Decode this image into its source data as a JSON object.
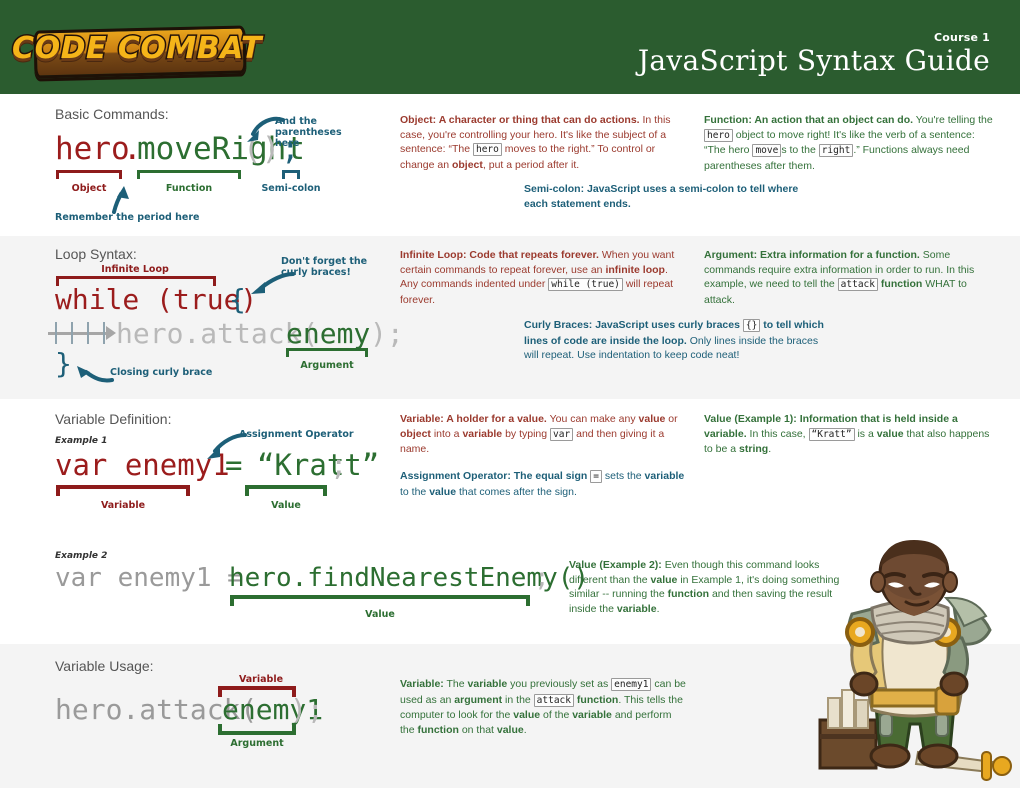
{
  "header": {
    "logo_text": "CODE COMBAT",
    "course_label": "Course 1",
    "title": "JavaScript Syntax Guide",
    "bg_color": "#2b5c2f"
  },
  "sections": [
    {
      "id": "basic-commands",
      "title": "Basic Commands:",
      "code": {
        "object": "hero",
        "dot": ".",
        "function": "moveRight",
        "parens": "()",
        "semicolon": ";"
      },
      "labels": {
        "object": "Object",
        "function": "Function",
        "semicolon": "Semi-colon",
        "parens_note_line1": "And the",
        "parens_note_line2": "parentheses here",
        "period_note": "Remember the period here"
      },
      "notes": [
        {
          "color": "#9b3a2e",
          "bold_lead": "Object: A character or thing that can do actions.",
          "body_1": " In this case, you're controlling your hero. It's like the subject of a sentence: “The ",
          "kb_1": "hero",
          "body_2": " moves to the right.” To control or change an ",
          "bold_2": "object",
          "body_3": ", put a period after it."
        },
        {
          "color": "#34713a",
          "bold_lead": "Function: An action that an object can do.",
          "body_1": " You're telling the ",
          "kb_1": "hero",
          "body_2": " object to move right! It's like the verb of a sentence: “The hero ",
          "kb_2": "move",
          "body_3": "s to the ",
          "kb_3": "right",
          "body_4": ".” Functions always need parentheses after them."
        },
        {
          "color": "#1d5f78",
          "bold_lead": "Semi-colon:  JavaScript uses a semi-colon to tell where each statement ends."
        }
      ]
    },
    {
      "id": "loop-syntax",
      "title": "Loop Syntax:",
      "code": {
        "line1": "while (true) {",
        "line1_keyword": "while (true)",
        "line1_brace": "{",
        "line2_prefix": "hero.attack(",
        "line2_arg": "enemy",
        "line2_suffix": ");",
        "line3": "}"
      },
      "labels": {
        "infinite_loop": "Infinite Loop",
        "argument": "Argument",
        "curly_note_line1": "Don't forget the",
        "curly_note_line2": "curly braces!",
        "closing_brace_note": "Closing curly brace"
      },
      "notes": [
        {
          "color": "#9b3a2e",
          "bold_lead": "Infinite Loop: Code that repeats forever.",
          "body_1": " When you want certain commands to repeat forever, use an ",
          "bold_2": "infinite loop",
          "body_2": ". Any commands indented under ",
          "kb_1": "while (true)",
          "body_3": " will repeat forever."
        },
        {
          "color": "#34713a",
          "bold_lead": "Argument: Extra information for a function.",
          "body_1": " Some commands require extra information in order to run. In this example, we need to tell the ",
          "kb_1": "attack",
          "bold_2": " function",
          "body_2": " WHAT to attack."
        },
        {
          "color": "#1d5f78",
          "bold_lead_1": "Curly Braces:  JavaScript uses curly braces ",
          "kb_1": "{}",
          "bold_lead_2": " to tell which lines of code are inside the loop.",
          "body_1": " Only lines inside the braces will repeat. Use indentation to keep code neat!"
        }
      ]
    },
    {
      "id": "variable-definition",
      "title": "Variable Definition:",
      "example1": {
        "label": "Example 1",
        "code_var": "var enemy1",
        "code_equals": "=",
        "code_value": "“Kratt”",
        "code_semi": ";",
        "label_variable": "Variable",
        "label_value": "Value",
        "label_operator": "Assignment Operator"
      },
      "example2": {
        "label": "Example 2",
        "code_var": "var enemy1 = ",
        "code_value": "hero.findNearestEnemy()",
        "code_semi": ";",
        "label_value": "Value"
      },
      "notes": [
        {
          "color": "#9b3a2e",
          "bold_lead": "Variable: A holder for a value.",
          "body_1": " You can make any ",
          "bold_2": "value",
          "body_2": " or ",
          "bold_3": "object",
          "body_3": " into a ",
          "bold_4": "variable",
          "body_4": " by typing ",
          "kb_1": "var",
          "body_5": " and then giving it a name."
        },
        {
          "color": "#1d5f78",
          "bold_lead": "Assignment Operator:  The equal sign ",
          "kb_1": "=",
          "body_1": " sets the ",
          "bold_2": "variable",
          "body_2": " to the ",
          "bold_3": "value",
          "body_3": " that comes after the sign."
        },
        {
          "color": "#34713a",
          "bold_lead": "Value (Example 1): Information that is held inside a variable.",
          "body_1": " In this case, ",
          "kb_1": "“Kratt”",
          "body_2": " is a ",
          "bold_2": "value",
          "body_3": " that also happens to be a ",
          "bold_3": "string",
          "body_4": "."
        },
        {
          "color": "#34713a",
          "bold_lead": "Value (Example 2):",
          "body_1": " Even though this command looks different than the ",
          "bold_2": "value",
          "body_2": " in Example 1, it's doing something similar -- running the ",
          "bold_3": "function",
          "body_3": " and then saving the result inside the ",
          "bold_4": "variable",
          "body_4": "."
        }
      ]
    },
    {
      "id": "variable-usage",
      "title": "Variable Usage:",
      "code": {
        "prefix": "hero.attack(",
        "arg": "enemy1",
        "suffix": ");"
      },
      "labels": {
        "variable": "Variable",
        "argument": "Argument"
      },
      "notes": [
        {
          "color": "#34713a",
          "bold_lead": "Variable:",
          "body_1": " The ",
          "bold_2": "variable",
          "body_2": " you previously set as ",
          "kb_1": "enemy1",
          "body_3": " can be used as an ",
          "bold_3": "argument",
          "body_4": " in the ",
          "kb_2": "attack",
          "bold_4": " function",
          "body_5": ". This tells the computer to look for the ",
          "bold_5": "value",
          "body_6": " of the ",
          "bold_6": "variable",
          "body_7": " and perform the ",
          "bold_7": "function",
          "body_8": " on that ",
          "bold_8": "value",
          "body_9": "."
        }
      ]
    }
  ],
  "colors": {
    "header_green": "#2b5c2f",
    "red": "#9b1c1c",
    "green": "#2c6e31",
    "teal": "#1d5f78",
    "gray_code": "#b9b9b9",
    "shade_bg": "#f4f4f4"
  },
  "illustration": {
    "name": "codecombat-hero-character"
  }
}
